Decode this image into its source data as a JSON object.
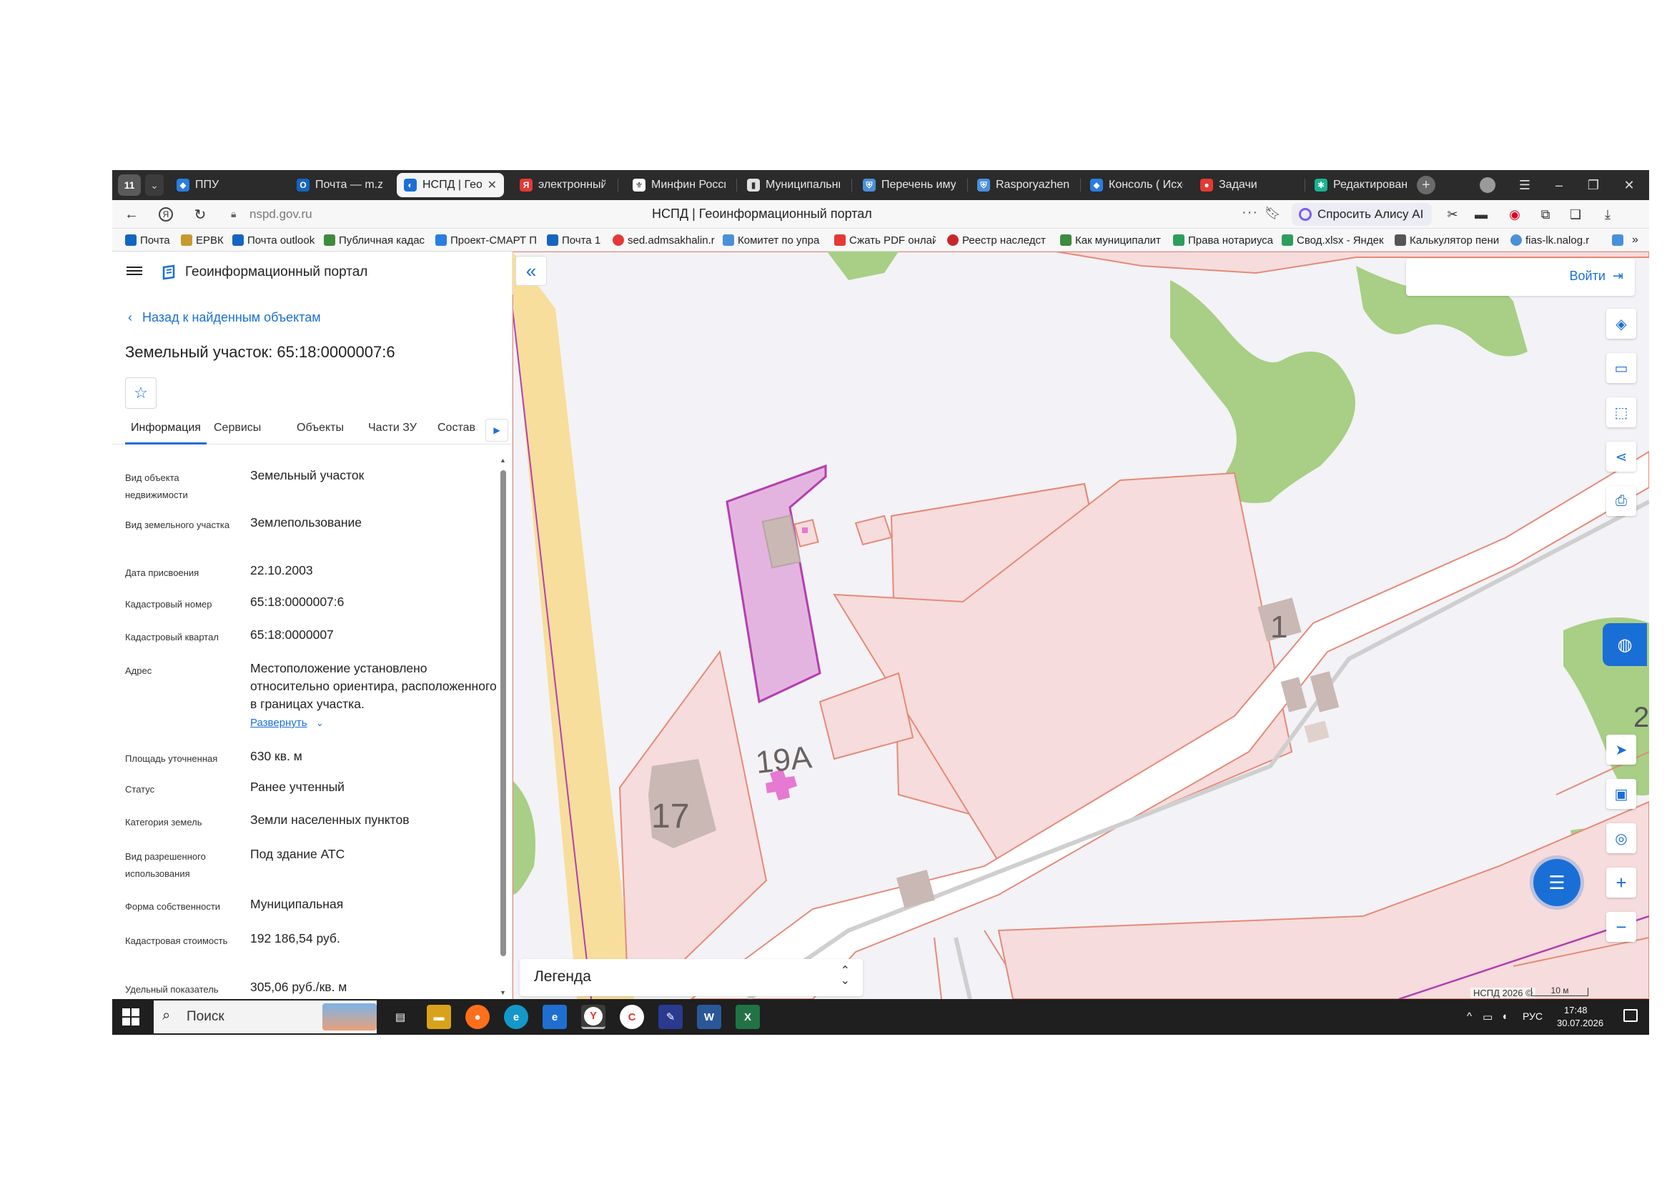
{
  "browser": {
    "workspace_badge": "11",
    "tabs": [
      {
        "title": "ППУ",
        "favicon_color": "#2a7de1"
      },
      {
        "title": "Почта — m.zhi",
        "favicon_color": "#1565c0"
      },
      {
        "title": "НСПД | Геои",
        "favicon_color": "#1a6fd6",
        "active": true
      },
      {
        "title": "электронный б",
        "favicon_color": "#e53935"
      },
      {
        "title": "Минфин Росси",
        "favicon_color": "#ffffff"
      },
      {
        "title": "Муниципальны",
        "favicon_color": "#e0e0e0"
      },
      {
        "title": "Перечень иму",
        "favicon_color": "#4a90d9"
      },
      {
        "title": "Rasporyazhenie",
        "favicon_color": "#4a90d9"
      },
      {
        "title": "Консоль ( Исхо",
        "favicon_color": "#2a7de1"
      },
      {
        "title": "Задачи",
        "favicon_color": "#e53935"
      },
      {
        "title": "Редактирование",
        "favicon_color": "#1ab394"
      }
    ],
    "url": "nspd.gov.ru",
    "page_title": "НСПД | Геоинформационный портал",
    "alice_button": "Спросить Алису AI",
    "bookmarks": [
      {
        "label": "Почта",
        "color": "#1565c0"
      },
      {
        "label": "ЕРВК",
        "color": "#c79a2d"
      },
      {
        "label": "Почта outlook",
        "color": "#1565c0"
      },
      {
        "label": "Публичная кадас",
        "color": "#3d8b3d"
      },
      {
        "label": "Проект-СМАРТ П",
        "color": "#2a7de1"
      },
      {
        "label": "Почта 1",
        "color": "#1565c0"
      },
      {
        "label": "sed.admsakhalin.r",
        "color": "#e53935"
      },
      {
        "label": "Комитет по упра",
        "color": "#4a90d9"
      },
      {
        "label": "Сжать PDF онлай",
        "color": "#e53935"
      },
      {
        "label": "Реестр наследст",
        "color": "#c62828"
      },
      {
        "label": "Как муниципалит",
        "color": "#3d8b3d"
      },
      {
        "label": "Права нотариуса",
        "color": "#2e9d5b"
      },
      {
        "label": "Свод.xlsx - Яндек",
        "color": "#2e9d5b"
      },
      {
        "label": "Калькулятор пени",
        "color": "#555555"
      },
      {
        "label": "fias-lk.nalog.r",
        "color": "#4a90d9"
      }
    ]
  },
  "portal": {
    "title": "Геоинформационный портал",
    "back_link": "Назад к найденным объектам",
    "object_title": "Земельный участок: 65:18:0000007:6",
    "tabs": [
      "Информация",
      "Сервисы",
      "Объекты",
      "Части ЗУ",
      "Состав"
    ],
    "attributes": [
      {
        "label": "Вид объекта недвижимости",
        "value": "Земельный участок"
      },
      {
        "label": "Вид земельного участка",
        "value": "Землепользование"
      },
      {
        "label": "Дата присвоения",
        "value": "22.10.2003"
      },
      {
        "label": "Кадастровый номер",
        "value": "65:18:0000007:6"
      },
      {
        "label": "Кадастровый квартал",
        "value": "65:18:0000007"
      },
      {
        "label": "Адрес",
        "value": "Местоположение установлено относительно ориентира, расположенного в границах участка."
      },
      {
        "label": "Площадь уточненная",
        "value": "630 кв. м"
      },
      {
        "label": "Статус",
        "value": "Ранее учтенный"
      },
      {
        "label": "Категория земель",
        "value": "Земли населенных пунктов"
      },
      {
        "label": "Вид разрешенного использования",
        "value": "Под здание АТС"
      },
      {
        "label": "Форма собственности",
        "value": "Муниципальная"
      },
      {
        "label": "Кадастровая стоимость",
        "value": "192 186,54 руб."
      },
      {
        "label": "Удельный показатель",
        "value": "305,06 руб./кв. м"
      }
    ],
    "expand_link": "Развернуть"
  },
  "map": {
    "login": "Войти",
    "legend": "Легенда",
    "copyright": "НСПД 2026 ©",
    "scale": "10 м",
    "labels": [
      "17",
      "19А",
      "1",
      "2"
    ],
    "colors": {
      "parcel_fill": "#f6dcdc",
      "parcel_stroke": "#e58a78",
      "selected_fill": "#e4b4e0",
      "selected_stroke": "#b43eb0",
      "green": "#a8cf85",
      "road": "#f8de9c",
      "building": "#c9b8b4"
    }
  },
  "taskbar": {
    "search_placeholder": "Поиск",
    "language": "РУС",
    "time": "17:48",
    "date": "30.07.2026"
  }
}
